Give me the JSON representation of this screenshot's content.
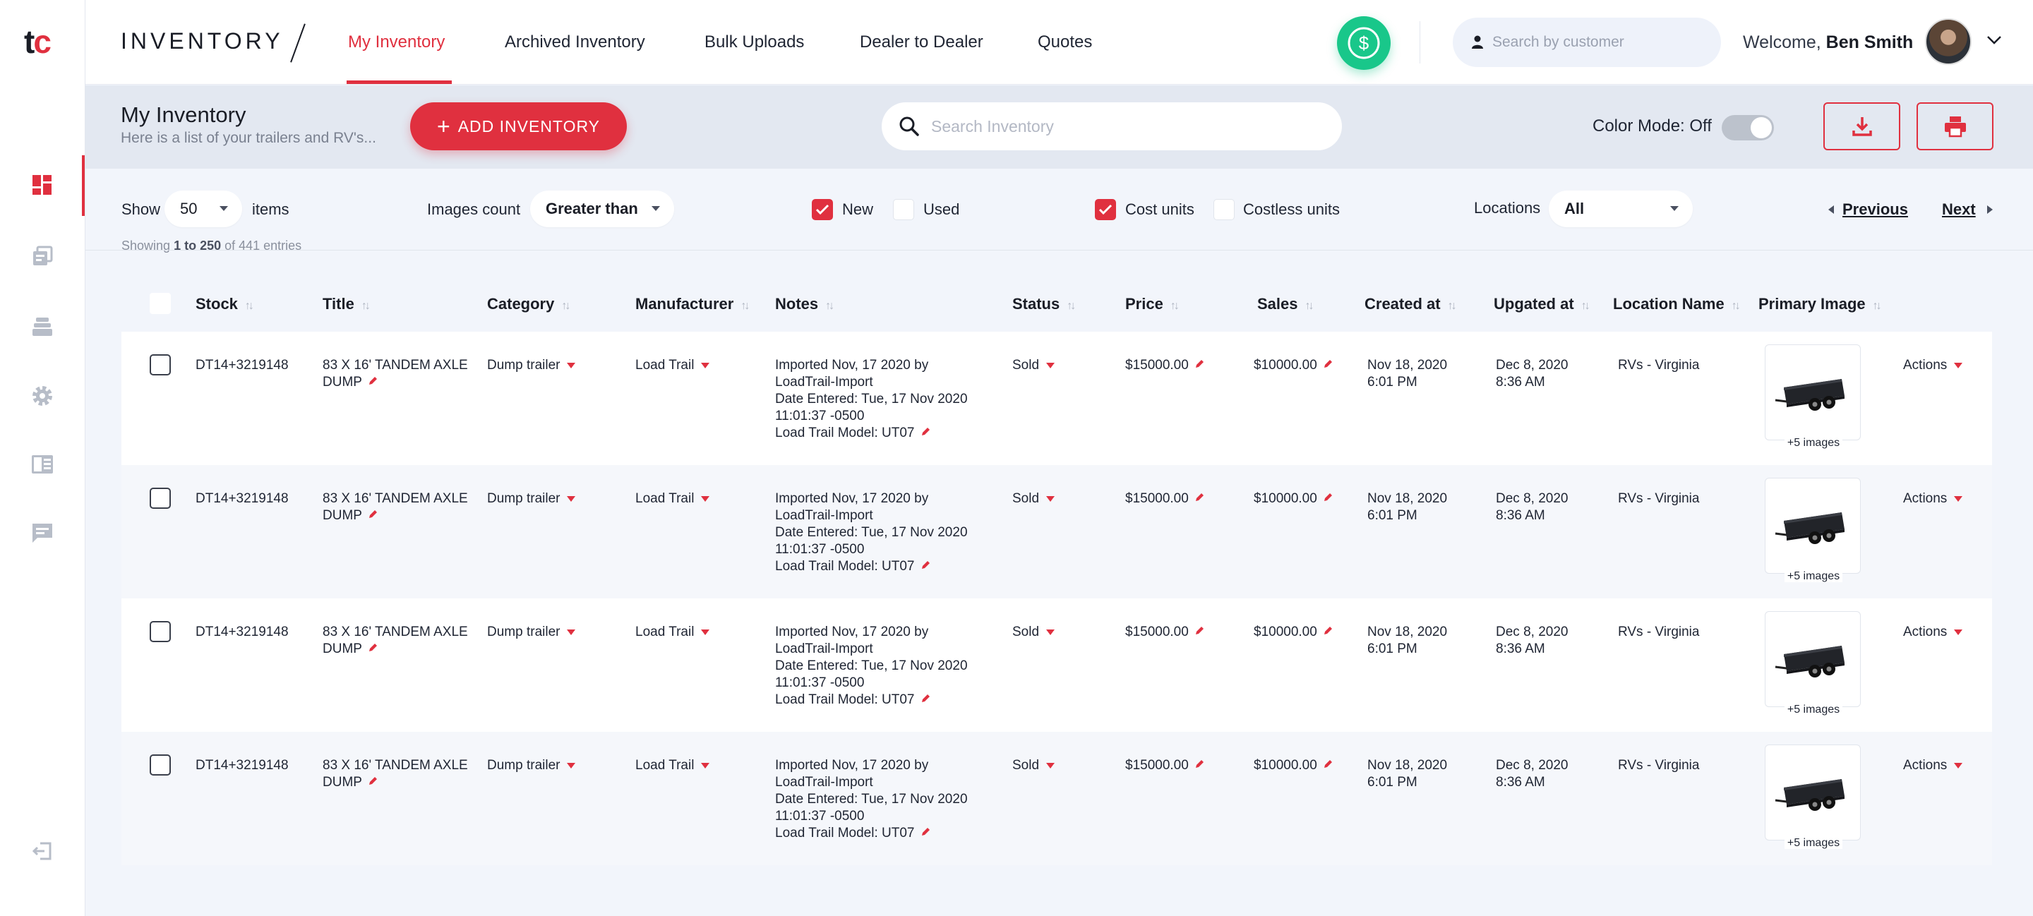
{
  "brand": {
    "logo_t": "t",
    "logo_c": "c",
    "title": "INVENTORY"
  },
  "nav": {
    "tabs": [
      "My Inventory",
      "Archived Inventory",
      "Bulk Uploads",
      "Dealer to Dealer",
      "Quotes"
    ],
    "active": "My Inventory"
  },
  "sidebar": {
    "icons": [
      "dashboard-icon",
      "inventory-icon",
      "layers-icon",
      "settings-icon",
      "book-icon",
      "chat-icon",
      "logout-icon"
    ],
    "active": "dashboard-icon"
  },
  "header": {
    "customer_search_placeholder": "Search by customer",
    "welcome_prefix": "Welcome, ",
    "user_name": "Ben Smith"
  },
  "page": {
    "title": "My Inventory",
    "subtitle": "Here is a list of your trailers and RV's...",
    "add_button": "ADD INVENTORY",
    "search_placeholder": "Search Inventory",
    "color_mode_label": "Color Mode: Off",
    "color_mode_on": false
  },
  "filters": {
    "show_label": "Show",
    "show_value": "50",
    "items_label": "items",
    "images_count_label": "Images count",
    "images_count_value": "Greater than",
    "new_label": "New",
    "new_checked": true,
    "used_label": "Used",
    "used_checked": false,
    "cost_units_label": "Cost units",
    "cost_units_checked": true,
    "costless_units_label": "Costless units",
    "costless_units_checked": false,
    "locations_label": "Locations",
    "locations_value": "All",
    "previous": "Previous",
    "next": "Next",
    "entries_prefix": "Showing ",
    "entries_range": "1 to 250",
    "entries_suffix": " of 441 entries"
  },
  "table": {
    "columns": [
      "Stock",
      "Title",
      "Category",
      "Manufacturer",
      "Notes",
      "Status",
      "Price",
      "Sales",
      "Created at",
      "Upgated at",
      "Location Name",
      "Primary Image"
    ],
    "rows": [
      {
        "stock": "DT14+3219148",
        "title_l1": "83 X 16' TANDEM AXLE",
        "title_l2": "DUMP",
        "category": "Dump trailer",
        "manufacturer": "Load Trail",
        "notes_l1": "Imported Nov, 17 2020 by",
        "notes_l2": "LoadTrail-Import",
        "notes_l3": "Date Entered: Tue, 17 Nov 2020",
        "notes_l4": "11:01:37 -0500",
        "notes_l5": "Load Trail Model: UT07",
        "status": "Sold",
        "price": "$15000.00",
        "sales": "$10000.00",
        "created_date": "Nov 18, 2020",
        "created_time": "6:01 PM",
        "updated_date": "Dec 8, 2020",
        "updated_time": "8:36 AM",
        "location": "RVs - Virginia",
        "images_caption": "+5 images",
        "actions": "Actions"
      },
      {
        "stock": "DT14+3219148",
        "title_l1": "83 X 16' TANDEM AXLE",
        "title_l2": "DUMP",
        "category": "Dump trailer",
        "manufacturer": "Load Trail",
        "notes_l1": "Imported Nov, 17 2020 by",
        "notes_l2": "LoadTrail-Import",
        "notes_l3": "Date Entered: Tue, 17 Nov 2020",
        "notes_l4": "11:01:37 -0500",
        "notes_l5": "Load Trail Model: UT07",
        "status": "Sold",
        "price": "$15000.00",
        "sales": "$10000.00",
        "created_date": "Nov 18, 2020",
        "created_time": "6:01 PM",
        "updated_date": "Dec 8, 2020",
        "updated_time": "8:36 AM",
        "location": "RVs - Virginia",
        "images_caption": "+5 images",
        "actions": "Actions"
      },
      {
        "stock": "DT14+3219148",
        "title_l1": "83 X 16' TANDEM AXLE",
        "title_l2": "DUMP",
        "category": "Dump trailer",
        "manufacturer": "Load Trail",
        "notes_l1": "Imported Nov, 17 2020 by",
        "notes_l2": "LoadTrail-Import",
        "notes_l3": "Date Entered: Tue, 17 Nov 2020",
        "notes_l4": "11:01:37 -0500",
        "notes_l5": "Load Trail Model: UT07",
        "status": "Sold",
        "price": "$15000.00",
        "sales": "$10000.00",
        "created_date": "Nov 18, 2020",
        "created_time": "6:01 PM",
        "updated_date": "Dec 8, 2020",
        "updated_time": "8:36 AM",
        "location": "RVs - Virginia",
        "images_caption": "+5 images",
        "actions": "Actions"
      },
      {
        "stock": "DT14+3219148",
        "title_l1": "83 X 16' TANDEM AXLE",
        "title_l2": "DUMP",
        "category": "Dump trailer",
        "manufacturer": "Load Trail",
        "notes_l1": "Imported Nov, 17 2020 by",
        "notes_l2": "LoadTrail-Import",
        "notes_l3": "Date Entered: Tue, 17 Nov 2020",
        "notes_l4": "11:01:37 -0500",
        "notes_l5": "Load Trail Model: UT07",
        "status": "Sold",
        "price": "$15000.00",
        "sales": "$10000.00",
        "created_date": "Nov 18, 2020",
        "created_time": "6:01 PM",
        "updated_date": "Dec 8, 2020",
        "updated_time": "8:36 AM",
        "location": "RVs - Virginia",
        "images_caption": "+5 images",
        "actions": "Actions"
      }
    ]
  },
  "colors": {
    "accent": "#e0303f",
    "money_button": "#19c78a",
    "page_background": "#f2f5fb",
    "header_band": "#e3e8f1"
  }
}
